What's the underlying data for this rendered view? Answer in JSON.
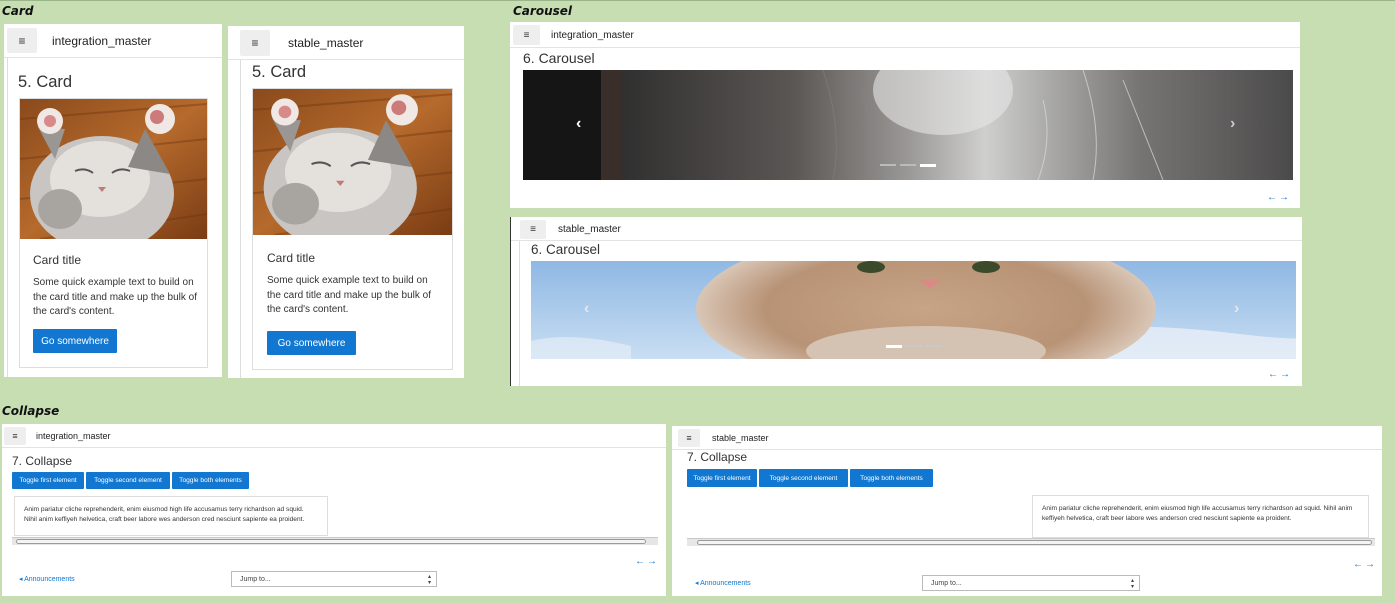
{
  "sections": {
    "card": "Card",
    "carousel": "Carousel",
    "collapse": "Collapse"
  },
  "colors": {
    "page_background": "#c6deb2",
    "primary_button": "#1177d1",
    "link": "#1177d1"
  },
  "icons": {
    "menu": "hamburger-icon",
    "carousel_prev": "chevron-left-icon",
    "carousel_next": "chevron-right-icon",
    "pager": "arrow-left-right-icon",
    "select_caret": "updown-caret-icon"
  },
  "card_panels": [
    {
      "branch": "integration_master",
      "heading": "5. Card",
      "card_title": "Card title",
      "card_text": "Some quick example text to build on the card title and make up the bulk of the card's content.",
      "button": "Go somewhere"
    },
    {
      "branch": "stable_master",
      "heading": "5. Card",
      "card_title": "Card title",
      "card_text": "Some quick example text to build on the card title and make up the bulk of the card's content.",
      "button": "Go somewhere"
    }
  ],
  "carousel_panels": [
    {
      "branch": "integration_master",
      "heading": "6. Carousel",
      "prev": "‹",
      "next": "›",
      "pager": "←→",
      "active_slide": 3,
      "slide_count": 3
    },
    {
      "branch": "stable_master",
      "heading": "6. Carousel",
      "prev": "‹",
      "next": "›",
      "pager": "←→",
      "active_slide": 1,
      "slide_count": 3
    }
  ],
  "collapse_panels": [
    {
      "branch": "integration_master",
      "heading": "7. Collapse",
      "buttons": [
        "Toggle first element",
        "Toggle second element",
        "Toggle both elements"
      ],
      "content": "Anim pariatur cliche reprehenderit, enim eiusmod high life accusamus terry richardson ad squid. Nihil anim keffiyeh helvetica, craft beer labore wes anderson cred nesciunt sapiente ea proident.",
      "pager": "←→",
      "prev_link": "◂ Announcements",
      "jump_placeholder": "Jump to..."
    },
    {
      "branch": "stable_master",
      "heading": "7. Collapse",
      "buttons": [
        "Toggle first element",
        "Toggle second element",
        "Toggle both elements"
      ],
      "content": "Anim pariatur cliche reprehenderit, enim eiusmod high life accusamus terry richardson ad squid. Nihil anim keffiyeh helvetica, craft beer labore wes anderson cred nesciunt sapiente ea proident.",
      "pager": "←→",
      "prev_link": "◂ Announcements",
      "jump_placeholder": "Jump to..."
    }
  ]
}
